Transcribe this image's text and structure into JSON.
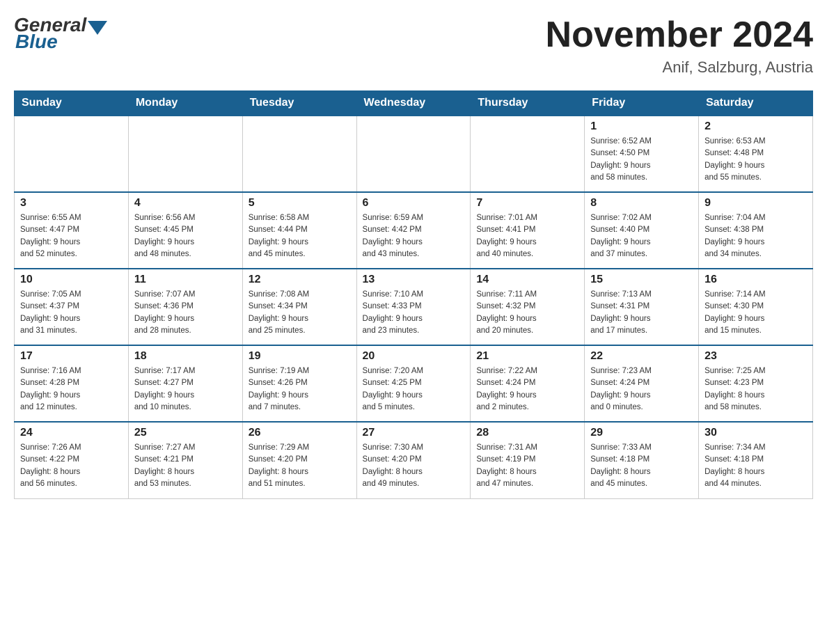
{
  "header": {
    "logo_general": "General",
    "logo_blue": "Blue",
    "title": "November 2024",
    "subtitle": "Anif, Salzburg, Austria"
  },
  "weekdays": [
    "Sunday",
    "Monday",
    "Tuesday",
    "Wednesday",
    "Thursday",
    "Friday",
    "Saturday"
  ],
  "weeks": [
    [
      {
        "day": "",
        "info": ""
      },
      {
        "day": "",
        "info": ""
      },
      {
        "day": "",
        "info": ""
      },
      {
        "day": "",
        "info": ""
      },
      {
        "day": "",
        "info": ""
      },
      {
        "day": "1",
        "info": "Sunrise: 6:52 AM\nSunset: 4:50 PM\nDaylight: 9 hours\nand 58 minutes."
      },
      {
        "day": "2",
        "info": "Sunrise: 6:53 AM\nSunset: 4:48 PM\nDaylight: 9 hours\nand 55 minutes."
      }
    ],
    [
      {
        "day": "3",
        "info": "Sunrise: 6:55 AM\nSunset: 4:47 PM\nDaylight: 9 hours\nand 52 minutes."
      },
      {
        "day": "4",
        "info": "Sunrise: 6:56 AM\nSunset: 4:45 PM\nDaylight: 9 hours\nand 48 minutes."
      },
      {
        "day": "5",
        "info": "Sunrise: 6:58 AM\nSunset: 4:44 PM\nDaylight: 9 hours\nand 45 minutes."
      },
      {
        "day": "6",
        "info": "Sunrise: 6:59 AM\nSunset: 4:42 PM\nDaylight: 9 hours\nand 43 minutes."
      },
      {
        "day": "7",
        "info": "Sunrise: 7:01 AM\nSunset: 4:41 PM\nDaylight: 9 hours\nand 40 minutes."
      },
      {
        "day": "8",
        "info": "Sunrise: 7:02 AM\nSunset: 4:40 PM\nDaylight: 9 hours\nand 37 minutes."
      },
      {
        "day": "9",
        "info": "Sunrise: 7:04 AM\nSunset: 4:38 PM\nDaylight: 9 hours\nand 34 minutes."
      }
    ],
    [
      {
        "day": "10",
        "info": "Sunrise: 7:05 AM\nSunset: 4:37 PM\nDaylight: 9 hours\nand 31 minutes."
      },
      {
        "day": "11",
        "info": "Sunrise: 7:07 AM\nSunset: 4:36 PM\nDaylight: 9 hours\nand 28 minutes."
      },
      {
        "day": "12",
        "info": "Sunrise: 7:08 AM\nSunset: 4:34 PM\nDaylight: 9 hours\nand 25 minutes."
      },
      {
        "day": "13",
        "info": "Sunrise: 7:10 AM\nSunset: 4:33 PM\nDaylight: 9 hours\nand 23 minutes."
      },
      {
        "day": "14",
        "info": "Sunrise: 7:11 AM\nSunset: 4:32 PM\nDaylight: 9 hours\nand 20 minutes."
      },
      {
        "day": "15",
        "info": "Sunrise: 7:13 AM\nSunset: 4:31 PM\nDaylight: 9 hours\nand 17 minutes."
      },
      {
        "day": "16",
        "info": "Sunrise: 7:14 AM\nSunset: 4:30 PM\nDaylight: 9 hours\nand 15 minutes."
      }
    ],
    [
      {
        "day": "17",
        "info": "Sunrise: 7:16 AM\nSunset: 4:28 PM\nDaylight: 9 hours\nand 12 minutes."
      },
      {
        "day": "18",
        "info": "Sunrise: 7:17 AM\nSunset: 4:27 PM\nDaylight: 9 hours\nand 10 minutes."
      },
      {
        "day": "19",
        "info": "Sunrise: 7:19 AM\nSunset: 4:26 PM\nDaylight: 9 hours\nand 7 minutes."
      },
      {
        "day": "20",
        "info": "Sunrise: 7:20 AM\nSunset: 4:25 PM\nDaylight: 9 hours\nand 5 minutes."
      },
      {
        "day": "21",
        "info": "Sunrise: 7:22 AM\nSunset: 4:24 PM\nDaylight: 9 hours\nand 2 minutes."
      },
      {
        "day": "22",
        "info": "Sunrise: 7:23 AM\nSunset: 4:24 PM\nDaylight: 9 hours\nand 0 minutes."
      },
      {
        "day": "23",
        "info": "Sunrise: 7:25 AM\nSunset: 4:23 PM\nDaylight: 8 hours\nand 58 minutes."
      }
    ],
    [
      {
        "day": "24",
        "info": "Sunrise: 7:26 AM\nSunset: 4:22 PM\nDaylight: 8 hours\nand 56 minutes."
      },
      {
        "day": "25",
        "info": "Sunrise: 7:27 AM\nSunset: 4:21 PM\nDaylight: 8 hours\nand 53 minutes."
      },
      {
        "day": "26",
        "info": "Sunrise: 7:29 AM\nSunset: 4:20 PM\nDaylight: 8 hours\nand 51 minutes."
      },
      {
        "day": "27",
        "info": "Sunrise: 7:30 AM\nSunset: 4:20 PM\nDaylight: 8 hours\nand 49 minutes."
      },
      {
        "day": "28",
        "info": "Sunrise: 7:31 AM\nSunset: 4:19 PM\nDaylight: 8 hours\nand 47 minutes."
      },
      {
        "day": "29",
        "info": "Sunrise: 7:33 AM\nSunset: 4:18 PM\nDaylight: 8 hours\nand 45 minutes."
      },
      {
        "day": "30",
        "info": "Sunrise: 7:34 AM\nSunset: 4:18 PM\nDaylight: 8 hours\nand 44 minutes."
      }
    ]
  ]
}
